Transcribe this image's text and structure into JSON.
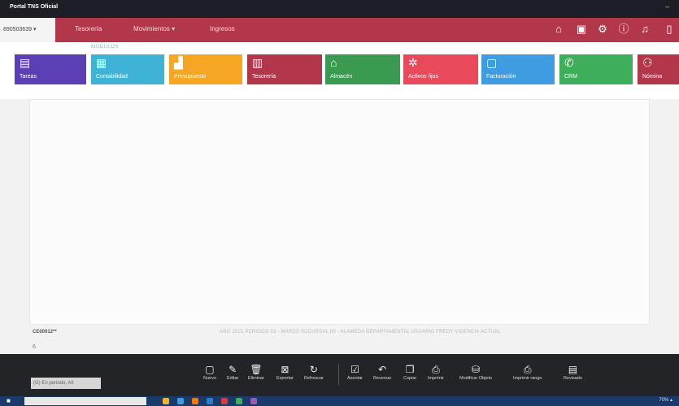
{
  "window": {
    "title": "Portal TNS Oficial",
    "controls": "–"
  },
  "navbar": {
    "company_code": "890503639 ▾",
    "items": [
      {
        "label": "Tesorería"
      },
      {
        "label": "Movimientos ▾"
      },
      {
        "label": "Ingresos"
      }
    ],
    "icons": [
      "home-icon",
      "calendar-icon",
      "gear-icon",
      "info-icon",
      "bell-icon",
      "user-icon"
    ]
  },
  "modules": {
    "label": "MÓDULOS",
    "tiles": [
      {
        "label": "Tareas",
        "color": "#5b3fb5",
        "icon": "tasks-icon"
      },
      {
        "label": "Contabilidad",
        "color": "#3fb3d6",
        "icon": "calculator-icon"
      },
      {
        "label": "Presupuesto",
        "color": "#f5a623",
        "icon": "budget-icon"
      },
      {
        "label": "Tesorería",
        "color": "#b3374b",
        "icon": "treasury-icon"
      },
      {
        "label": "Almacén",
        "color": "#3a9a4f",
        "icon": "warehouse-icon"
      },
      {
        "label": "Activos fijos",
        "color": "#e8495b",
        "icon": "assets-icon"
      },
      {
        "label": "Facturación",
        "color": "#3f9ce0",
        "icon": "invoice-icon"
      },
      {
        "label": "CRM",
        "color": "#3fae5a",
        "icon": "phone-icon"
      },
      {
        "label": "Nómina",
        "color": "#b3374b",
        "icon": "payroll-icon"
      }
    ]
  },
  "status": {
    "code": "CE00012**",
    "info": "AÑO 2021   PERIODO 03 - MARZO   SUCURSAL 00 - ALAMEDA DEPARTAMENTAL   USUARIO FREDY   VIGENCIA ACTUAL",
    "number": "6"
  },
  "toolbar": {
    "search_placeholder": "(G) En periodo, Alt",
    "buttons": [
      {
        "label": "Nuevo",
        "glyph": "▢"
      },
      {
        "label": "Editar",
        "glyph": "✎"
      },
      {
        "label": "Eliminar",
        "glyph": "🗑"
      },
      {
        "label": "Exportar",
        "glyph": "⊠"
      },
      {
        "label": "Refrescar",
        "glyph": "↻"
      },
      {
        "label": "Asentar",
        "glyph": "☑"
      },
      {
        "label": "Reversar",
        "glyph": "↶"
      },
      {
        "label": "Copiar",
        "glyph": "❐"
      },
      {
        "label": "Imprimir",
        "glyph": "⎙"
      },
      {
        "label": "Modificar Objeto",
        "glyph": "⛁"
      },
      {
        "label": "Imprimir rango",
        "glyph": "⎙"
      },
      {
        "label": "Revisado",
        "glyph": "▤"
      }
    ]
  },
  "taskbar": {
    "clock": "70% ▴"
  }
}
